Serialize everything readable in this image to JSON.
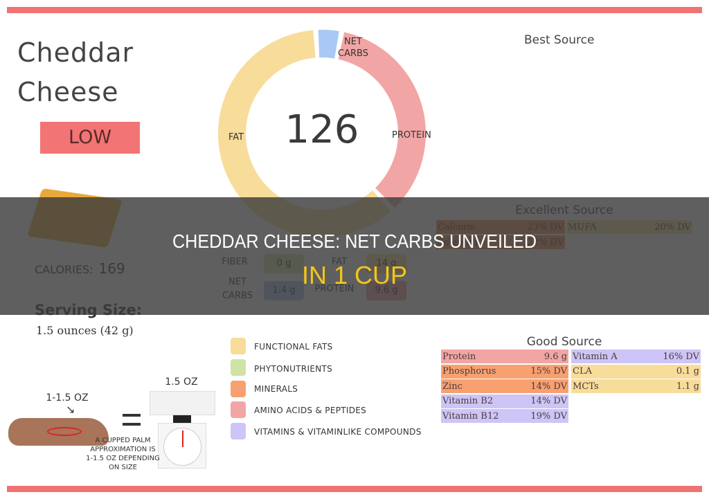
{
  "food": {
    "name_line1": "Cheddar",
    "name_line2": "Cheese",
    "rating": "LOW"
  },
  "calories": {
    "label": "CALORIES:",
    "value": "169"
  },
  "serving": {
    "label": "Serving Size:",
    "value": "1.5 ounces (42 g)"
  },
  "chart_data": {
    "type": "pie",
    "title": "",
    "center_value": "126",
    "labels": [
      "FAT",
      "NET CARBS",
      "PROTEIN"
    ],
    "values": [
      61,
      4,
      35
    ],
    "colors": [
      "#f8dc9a",
      "#a9c8f4",
      "#f2a5a5"
    ]
  },
  "donut_labels": {
    "fat": "FAT",
    "net_carbs_1": "NET",
    "net_carbs_2": "CARBS",
    "protein": "PROTEIN"
  },
  "macros": {
    "fiber_label": "FIBER",
    "fiber_value": "0 g",
    "net_carbs_label_1": "NET",
    "net_carbs_label_2": "CARBS",
    "net_carbs_value": "1.4 g",
    "fat_label": "FAT",
    "fat_value": "14 g",
    "protein_label": "PROTEIN",
    "protein_value": "9.6 g"
  },
  "best_source": {
    "title": "Best Source"
  },
  "excellent_source": {
    "title": "Excellent Source",
    "rows": [
      {
        "name": "Calcium",
        "value": "23% DV",
        "color": "#f0905a"
      },
      {
        "name": "Selenium",
        "value": "22% DV",
        "color": "#f0905a"
      },
      {
        "name": "MUFA",
        "value": "20% DV",
        "color": "#f8dc9a"
      }
    ]
  },
  "good_source": {
    "title": "Good Source",
    "left": [
      {
        "name": "Protein",
        "value": "9.6 g",
        "color": "#f2a5a5"
      },
      {
        "name": "Phosphorus",
        "value": "15% DV",
        "color": "#f7a070"
      },
      {
        "name": "Zinc",
        "value": "14% DV",
        "color": "#f7a070"
      },
      {
        "name": "Vitamin B2",
        "value": "14% DV",
        "color": "#cdc5f7"
      },
      {
        "name": "Vitamin B12",
        "value": "19% DV",
        "color": "#cdc5f7"
      }
    ],
    "right": [
      {
        "name": "Vitamin A",
        "value": "16% DV",
        "color": "#cdc5f7"
      },
      {
        "name": "CLA",
        "value": "0.1 g",
        "color": "#f8dc9a"
      },
      {
        "name": "MCTs",
        "value": "1.1 g",
        "color": "#f8dc9a"
      }
    ]
  },
  "legend": [
    {
      "label": "FUNCTIONAL  FATS",
      "color": "#f8dc9a"
    },
    {
      "label": "PHYTONUTRIENTS",
      "color": "#cfe3a4"
    },
    {
      "label": "MINERALS",
      "color": "#f7a070"
    },
    {
      "label": "AMINO ACIDS & PEPTIDES",
      "color": "#f2a5a5"
    },
    {
      "label": "VITAMINS & VITAMINLIKE COMPOUNDS",
      "color": "#cdc5f7"
    }
  ],
  "portion": {
    "hand_label": "1-1.5 OZ",
    "scale_label": "1.5 OZ",
    "note_1": "A CUPPED PALM",
    "note_2": "APPROXIMATION IS",
    "note_3": "1-1.5 OZ DEPENDING",
    "note_4": "ON SIZE"
  },
  "overlay": {
    "headline": "CHEDDAR CHEESE: NET CARBS UNVEILED",
    "subheadline": "IN 1 CUP"
  }
}
